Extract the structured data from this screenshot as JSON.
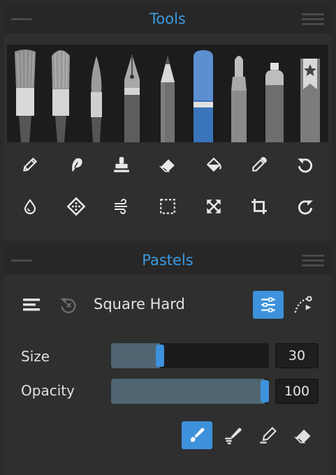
{
  "tools_panel": {
    "title": "Tools"
  },
  "pastels_panel": {
    "title": "Pastels",
    "brush_name": "Square Hard",
    "size": {
      "label": "Size",
      "value": "30",
      "fraction": 0.3
    },
    "opacity": {
      "label": "Opacity",
      "value": "100",
      "fraction": 1.0
    }
  },
  "brushes": [
    "oil-brush",
    "dry-brush",
    "watercolor-brush",
    "ink-pen",
    "pencil",
    "pastel",
    "marker",
    "spray-can",
    "favorites"
  ],
  "selected_brush": "pastel",
  "tool_icons": [
    "pencil-icon",
    "leaf-smudge-icon",
    "stamp-icon",
    "eraser-icon",
    "fill-bucket-icon",
    "eyedropper-icon",
    "undo-icon",
    "water-drop-icon",
    "texture-icon",
    "wind-icon",
    "selection-icon",
    "transform-icon",
    "crop-icon",
    "redo-icon"
  ],
  "colors": {
    "accent": "#3d92db",
    "title": "#3d9ae0",
    "background": "#2f2f2f"
  }
}
